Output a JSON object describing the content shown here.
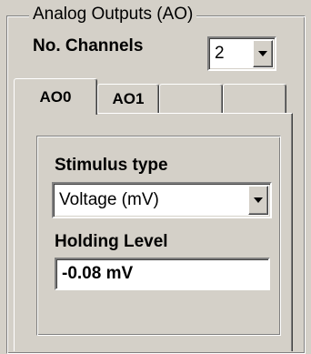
{
  "group": {
    "title": "Analog Outputs (AO)"
  },
  "channels": {
    "label": "No. Channels",
    "value": "2"
  },
  "tabs": [
    {
      "label": "AO0",
      "active": true
    },
    {
      "label": "AO1",
      "active": false
    },
    {
      "label": "",
      "active": false
    },
    {
      "label": "",
      "active": false
    }
  ],
  "stimulus": {
    "label": "Stimulus type",
    "value": "Voltage (mV)"
  },
  "holding": {
    "label": "Holding Level",
    "value": "-0.08 mV"
  }
}
